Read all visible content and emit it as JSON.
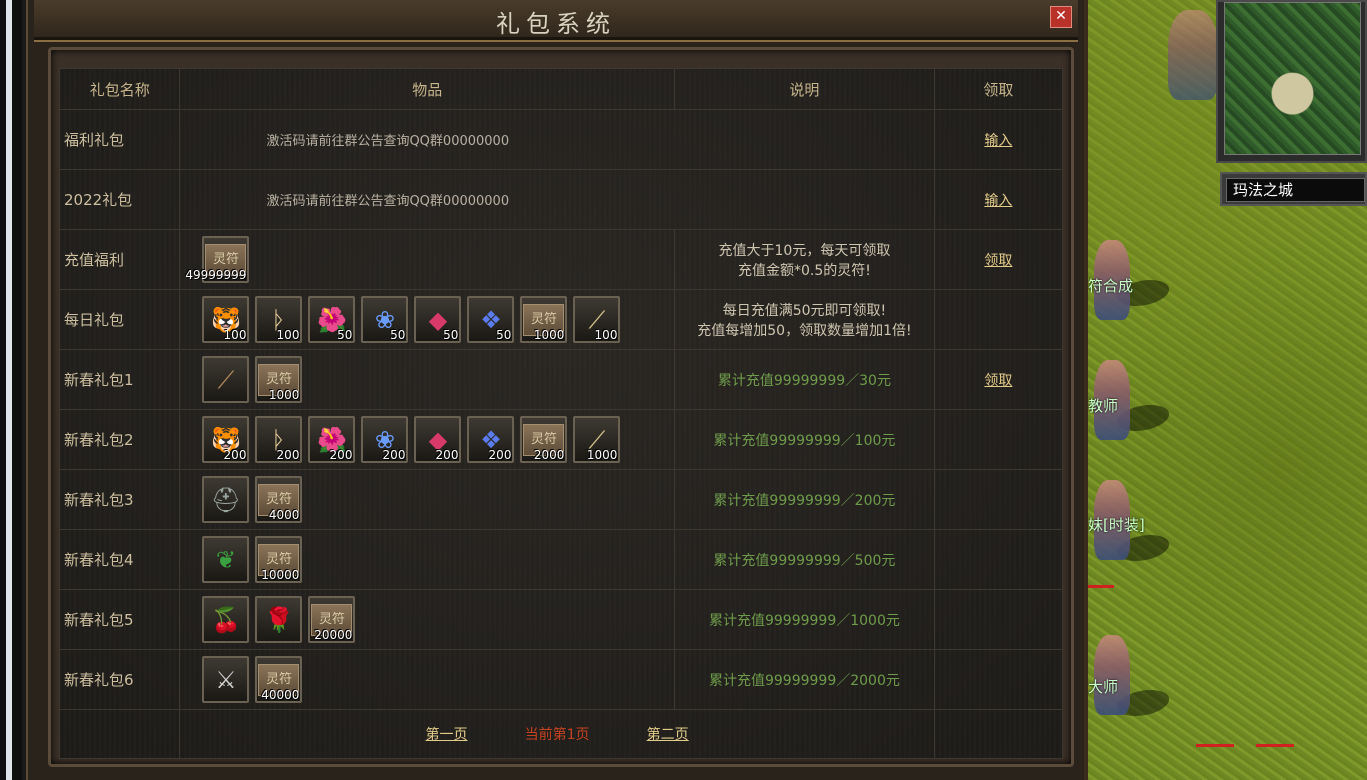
{
  "window": {
    "title": "礼包系统",
    "close_icon": "✕"
  },
  "table": {
    "headers": {
      "name": "礼包名称",
      "items": "物品",
      "desc": "说明",
      "claim": "领取"
    },
    "rows": [
      {
        "name": "福利礼包",
        "notice": "激活码请前往群公告查询QQ群00000000",
        "claim": "输入"
      },
      {
        "name": "2022礼包",
        "notice": "激活码请前往群公告查询QQ群00000000",
        "claim": "输入"
      },
      {
        "name": "充值福利",
        "items": [
          {
            "icon": "lingfu",
            "label": "灵符",
            "qty": "49999999"
          }
        ],
        "desc": [
          "充值大于10元，每天可领取",
          "充值金额*0.5的灵符!"
        ],
        "claim": "领取"
      },
      {
        "name": "每日礼包",
        "items": [
          {
            "icon": "tiger-helmet",
            "qty": "100"
          },
          {
            "icon": "rune",
            "qty": "100"
          },
          {
            "icon": "red-petal",
            "qty": "50"
          },
          {
            "icon": "blue-flower",
            "qty": "50"
          },
          {
            "icon": "red-gem",
            "qty": "50"
          },
          {
            "icon": "blue-crystal",
            "qty": "50"
          },
          {
            "icon": "lingfu",
            "label": "灵符",
            "qty": "1000"
          },
          {
            "icon": "bone-blade",
            "qty": "100"
          }
        ],
        "desc": [
          "每日充值满50元即可领取!",
          "充值每增加50，领取数量增加1倍!"
        ]
      },
      {
        "name": "新春礼包1",
        "items": [
          {
            "icon": "spear"
          },
          {
            "icon": "lingfu",
            "label": "灵符",
            "qty": "1000"
          }
        ],
        "desc_green": "累计充值99999999／30元",
        "claim": "领取"
      },
      {
        "name": "新春礼包2",
        "items": [
          {
            "icon": "tiger-helmet",
            "qty": "200"
          },
          {
            "icon": "rune",
            "qty": "200"
          },
          {
            "icon": "red-petal",
            "qty": "200"
          },
          {
            "icon": "blue-flower",
            "qty": "200"
          },
          {
            "icon": "red-gem",
            "qty": "200"
          },
          {
            "icon": "blue-crystal",
            "qty": "200"
          },
          {
            "icon": "lingfu",
            "label": "灵符",
            "qty": "2000"
          },
          {
            "icon": "bone-blade",
            "qty": "1000"
          }
        ],
        "desc_green": "累计充值99999999／100元"
      },
      {
        "name": "新春礼包3",
        "items": [
          {
            "icon": "steel-helmet"
          },
          {
            "icon": "lingfu",
            "label": "灵符",
            "qty": "4000"
          }
        ],
        "desc_green": "累计充值99999999／200元"
      },
      {
        "name": "新春礼包4",
        "items": [
          {
            "icon": "necklace"
          },
          {
            "icon": "lingfu",
            "label": "灵符",
            "qty": "10000"
          }
        ],
        "desc_green": "累计充值99999999／500元"
      },
      {
        "name": "新春礼包5",
        "items": [
          {
            "icon": "cherry"
          },
          {
            "icon": "rose"
          },
          {
            "icon": "lingfu",
            "label": "灵符",
            "qty": "20000"
          }
        ],
        "desc_green": "累计充值99999999／1000元"
      },
      {
        "name": "新春礼包6",
        "items": [
          {
            "icon": "sword"
          },
          {
            "icon": "lingfu",
            "label": "灵符",
            "qty": "40000"
          }
        ],
        "desc_green": "累计充值99999999／2000元"
      }
    ]
  },
  "pager": {
    "first": "第一页",
    "current": "当前第1页",
    "second": "第二页"
  },
  "world": {
    "map_name": "玛法之城",
    "npc_labels": [
      "符合成",
      "教师",
      "妹[时装]",
      "大师"
    ]
  }
}
